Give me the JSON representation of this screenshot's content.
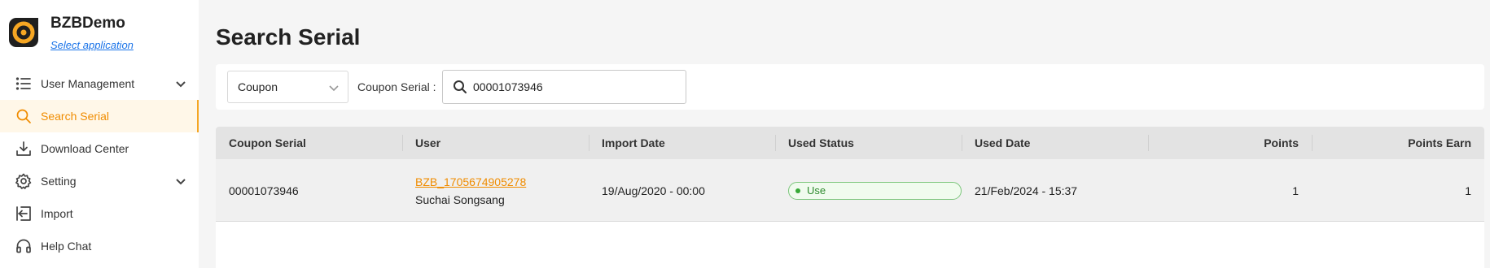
{
  "app": {
    "name": "BZBDemo",
    "select_app_label": "Select application"
  },
  "sidebar": {
    "items": [
      {
        "label": "User Management",
        "icon": "list-icon",
        "expandable": true
      },
      {
        "label": "Search Serial",
        "icon": "search-icon",
        "active": true
      },
      {
        "label": "Download Center",
        "icon": "download-icon"
      },
      {
        "label": "Setting",
        "icon": "gear-icon",
        "expandable": true
      },
      {
        "label": "Import",
        "icon": "import-icon"
      },
      {
        "label": "Help Chat",
        "icon": "headset-icon"
      }
    ]
  },
  "page": {
    "title": "Search Serial"
  },
  "filter": {
    "type_selected": "Coupon",
    "serial_label": "Coupon Serial :",
    "serial_value": "00001073946"
  },
  "table": {
    "headers": [
      "Coupon Serial",
      "User",
      "Import Date",
      "Used Status",
      "Used Date",
      "Points",
      "Points Earn"
    ],
    "rows": [
      {
        "coupon_serial": "00001073946",
        "user_id": "BZB_1705674905278",
        "user_name": "Suchai Songsang",
        "import_date": "19/Aug/2020 - 00:00",
        "used_status": "Use",
        "used_date": "21/Feb/2024 - 15:37",
        "points": "1",
        "points_earn": "1"
      }
    ]
  },
  "colors": {
    "accent": "#f08c00",
    "link": "#1a73e8",
    "status_green": "#2d8a2d"
  }
}
